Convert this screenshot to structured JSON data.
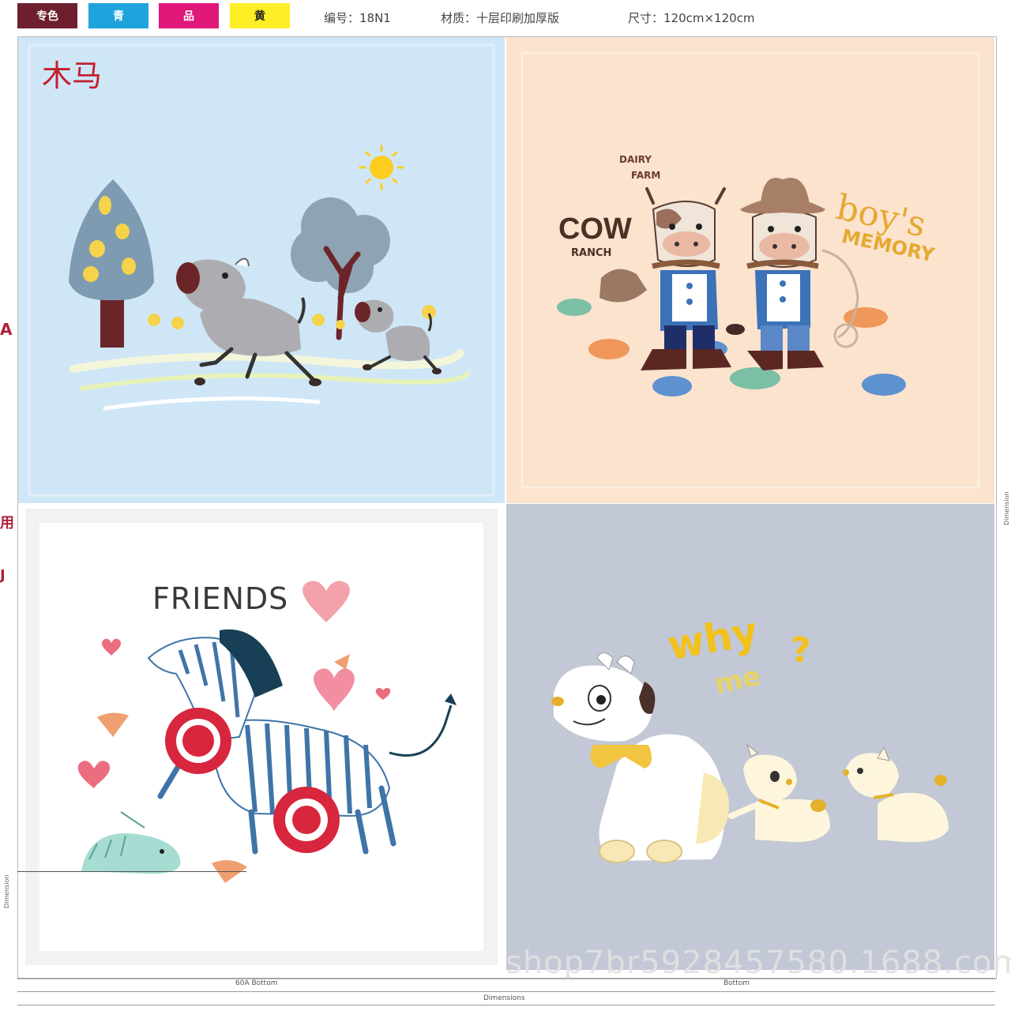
{
  "header": {
    "swatches": [
      {
        "label": "专色",
        "color": "#6e1f2e",
        "text_color": "#ffffff"
      },
      {
        "label": "青",
        "color": "#1fa3dc",
        "text_color": "#ffffff"
      },
      {
        "label": "品",
        "color": "#e0187a",
        "text_color": "#ffffff"
      },
      {
        "label": "黄",
        "color": "#ffef26",
        "text_color": "#222222"
      }
    ],
    "spec_1": "编号：18N1",
    "spec_2": "材质：十层印刷加厚版",
    "spec_3": "尺寸：120cm×120cm"
  },
  "tiles": {
    "horse": {
      "title": "木马",
      "bg": "#cfe6f7"
    },
    "cow": {
      "title": "COW",
      "small_text_1": "DAIRY",
      "small_text_2": "FARM",
      "sub": "RANCH",
      "script_1": "boy's",
      "script_2": "MEMORY",
      "bg": "#fbe3ce"
    },
    "zebra": {
      "title": "FRIENDS",
      "bg": "#ffffff"
    },
    "dog": {
      "title_1": "why",
      "title_2": "me",
      "bg": "#c2c8d5"
    }
  },
  "footer": {
    "label_left": "60A Bottom",
    "label_right": "Bottom",
    "label_center": "Dimensions",
    "side_left": "Dimension",
    "side_right": "Dimension"
  },
  "side_marks": [
    "A",
    "用",
    "J"
  ],
  "watermark": "shop7br5928457580.1688.com"
}
